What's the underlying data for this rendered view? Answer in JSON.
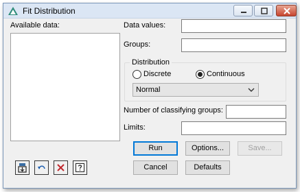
{
  "window": {
    "title": "Fit Distribution"
  },
  "titlebar_icons": [
    "minimize-icon",
    "maximize-icon",
    "close-icon"
  ],
  "left": {
    "available_label": "Available data:"
  },
  "fields": {
    "data_values_label": "Data values:",
    "data_values_value": "",
    "groups_label": "Groups:",
    "groups_value": "",
    "num_classifying_label": "Number of classifying groups:",
    "num_classifying_value": "",
    "limits_label": "Limits:",
    "limits_value": ""
  },
  "distribution": {
    "title": "Distribution",
    "discrete_label": "Discrete",
    "continuous_label": "Continuous",
    "selected": "Continuous",
    "select_value": "Normal"
  },
  "buttons": {
    "run": "Run",
    "options": "Options...",
    "save": "Save...",
    "cancel": "Cancel",
    "defaults": "Defaults"
  },
  "tool_icons": [
    "transfer-icon",
    "undo-icon",
    "clear-icon",
    "help-icon"
  ],
  "colors": {
    "default_button_border": "#0078d7",
    "titlebar": "#dbe6f4",
    "close_button": "#c7452f"
  }
}
